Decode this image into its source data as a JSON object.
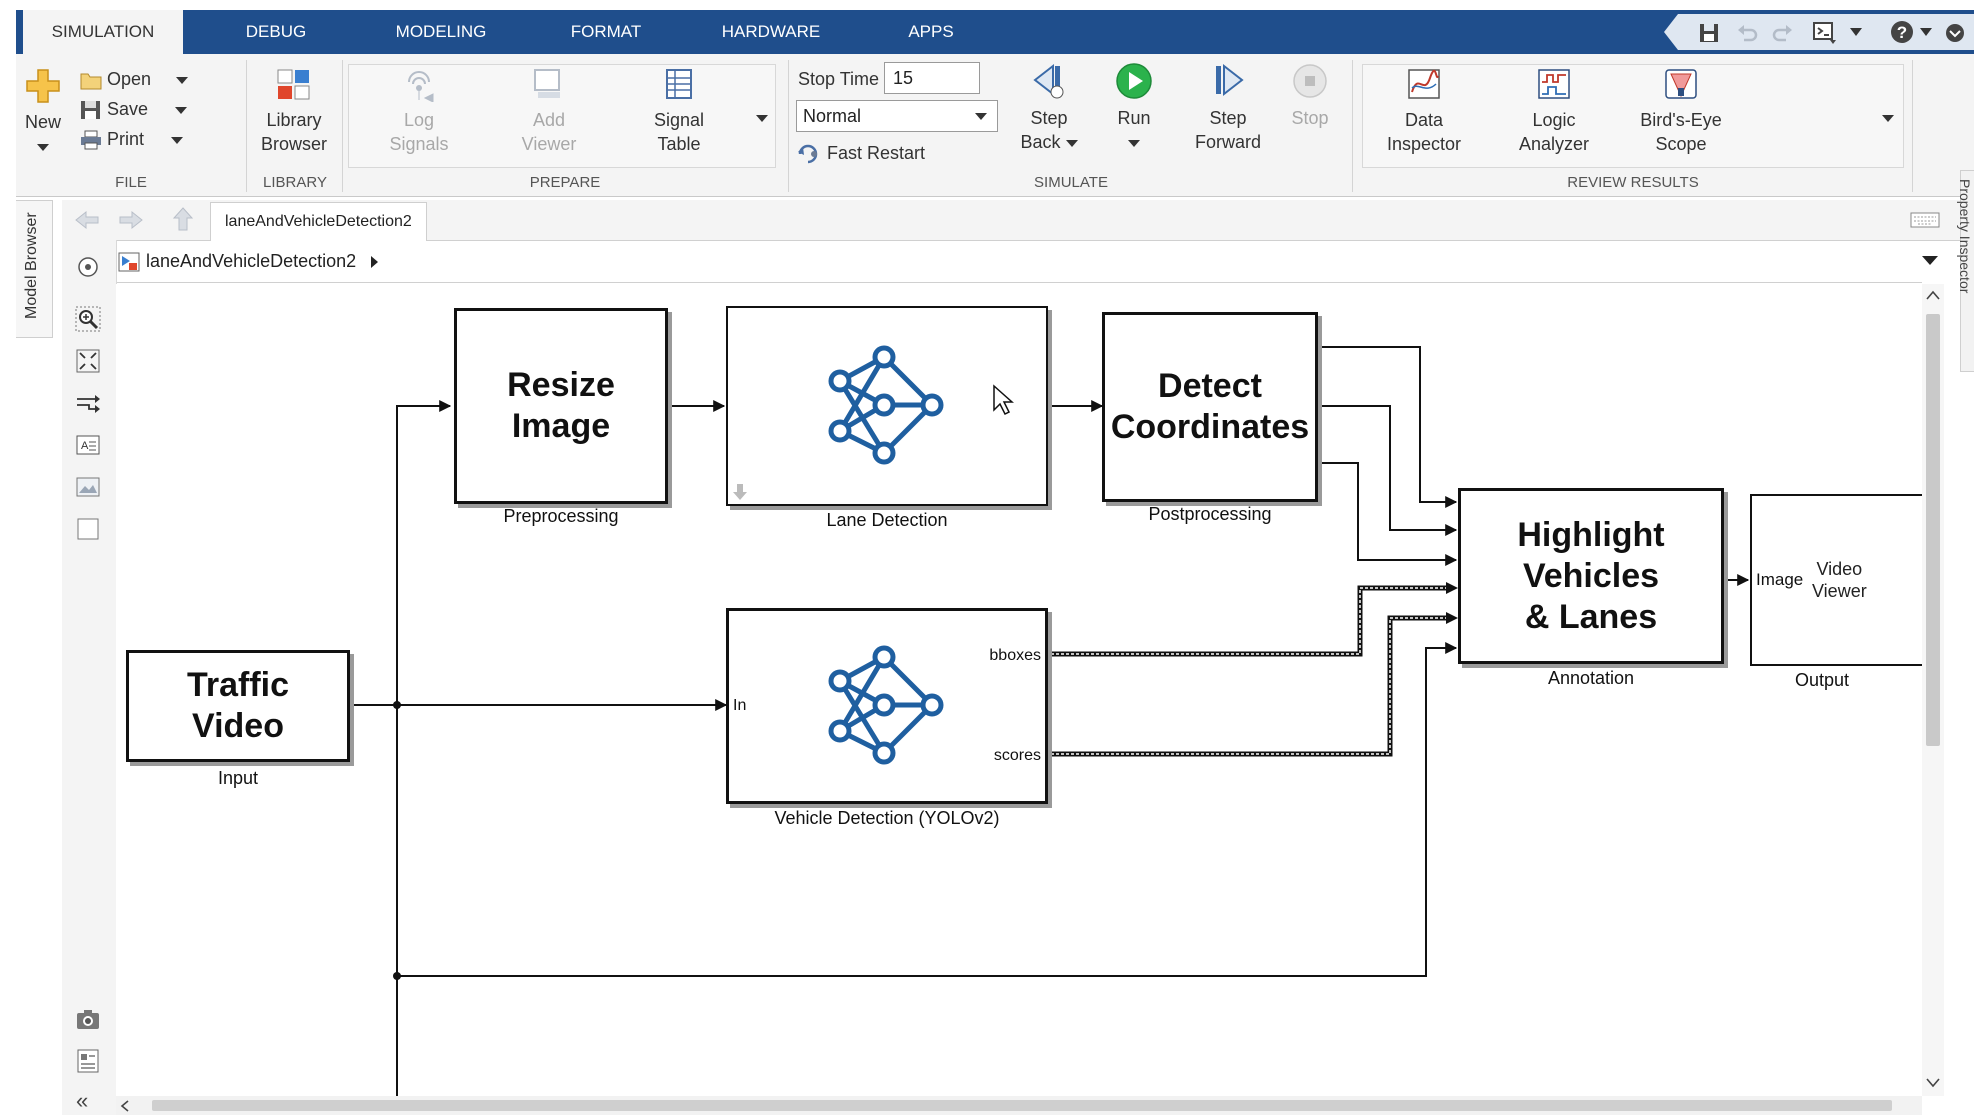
{
  "tabs": [
    "SIMULATION",
    "DEBUG",
    "MODELING",
    "FORMAT",
    "HARDWARE",
    "APPS"
  ],
  "ribbon": {
    "file": {
      "label": "FILE",
      "new": "New",
      "open": "Open",
      "save": "Save",
      "print": "Print"
    },
    "library": {
      "label": "LIBRARY",
      "browser_line1": "Library",
      "browser_line2": "Browser"
    },
    "prepare": {
      "label": "PREPARE",
      "log1": "Log",
      "log2": "Signals",
      "add1": "Add",
      "add2": "Viewer",
      "sig1": "Signal",
      "sig2": "Table"
    },
    "simulate": {
      "label": "SIMULATE",
      "stop_time_label": "Stop Time",
      "stop_time_value": "15",
      "mode": "Normal",
      "fast_restart": "Fast Restart",
      "step_back1": "Step",
      "step_back2": "Back",
      "run": "Run",
      "step_fwd1": "Step",
      "step_fwd2": "Forward",
      "stop": "Stop"
    },
    "review": {
      "label": "REVIEW RESULTS",
      "di1": "Data",
      "di2": "Inspector",
      "la1": "Logic",
      "la2": "Analyzer",
      "be1": "Bird's-Eye",
      "be2": "Scope"
    }
  },
  "side": {
    "model_browser": "Model Browser",
    "property_inspector": "Property Inspector"
  },
  "nav": {
    "model_tab": "laneAndVehicleDetection2",
    "breadcrumb": "laneAndVehicleDetection2"
  },
  "blocks": {
    "traffic_video": {
      "title": "Traffic\nVideo",
      "caption": "Input"
    },
    "resize_image": {
      "title": "Resize\nImage",
      "caption": "Preprocessing"
    },
    "lane_detection": {
      "caption": "Lane Detection"
    },
    "detect_coordinates": {
      "title": "Detect\nCoordinates",
      "caption": "Postprocessing"
    },
    "vehicle_detection": {
      "caption": "Vehicle Detection (YOLOv2)",
      "port_in": "In",
      "port_bboxes": "bboxes",
      "port_scores": "scores"
    },
    "highlight": {
      "title": "Highlight\nVehicles\n& Lanes",
      "caption": "Annotation"
    },
    "video_viewer": {
      "title": "Video\nViewer",
      "port_image": "Image",
      "caption": "Output"
    }
  },
  "colors": {
    "tabbar": "#1f4e8c",
    "nn_icon": "#1f5fa0",
    "run_green": "#2bb24c"
  }
}
